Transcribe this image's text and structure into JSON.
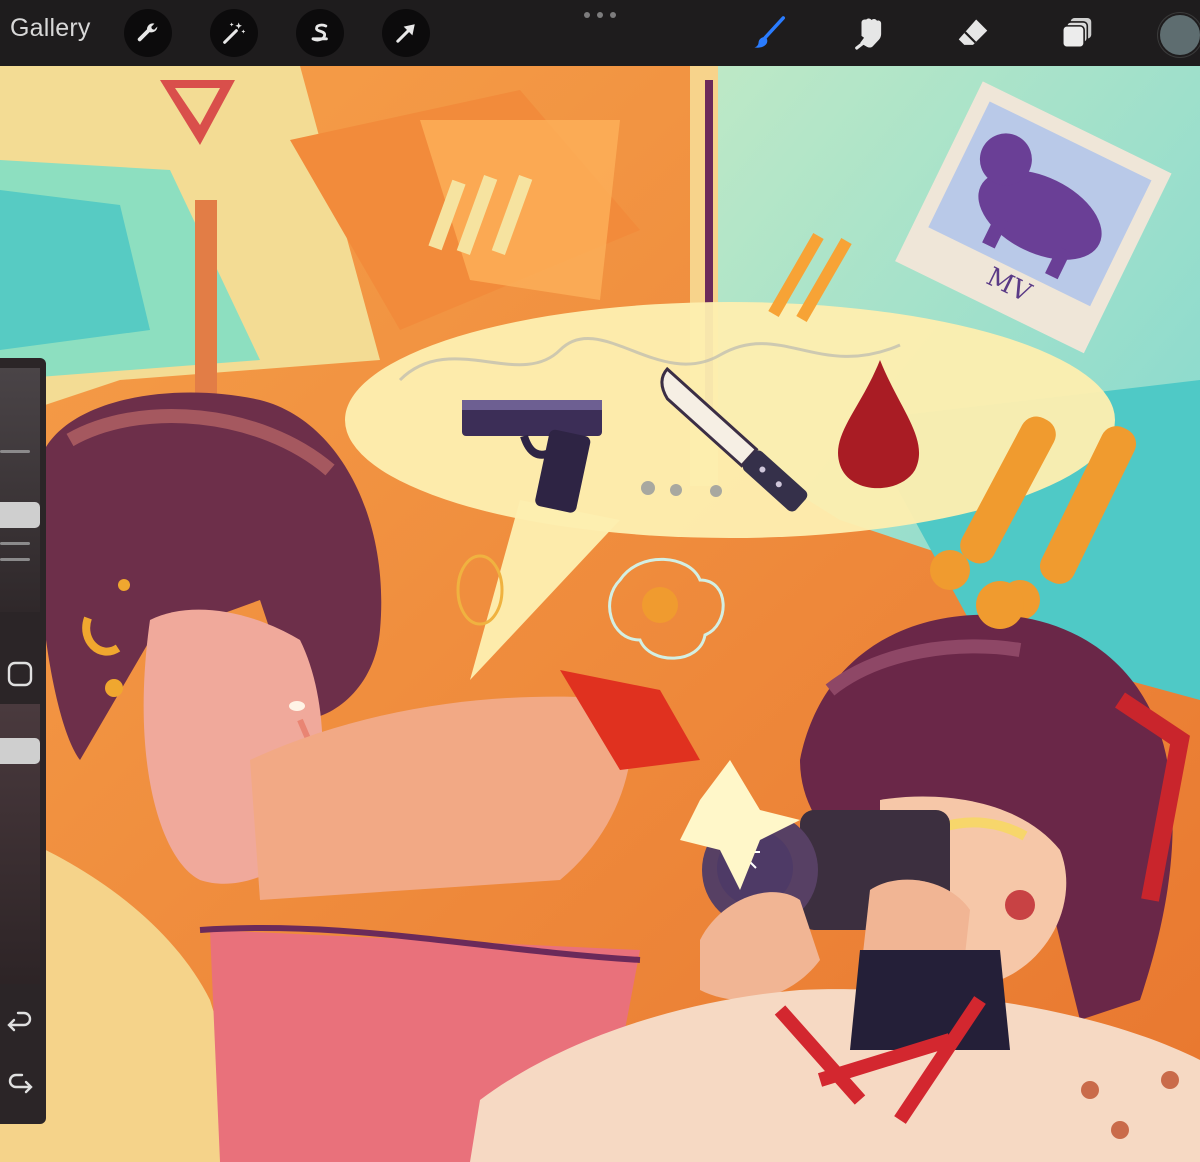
{
  "toolbar": {
    "gallery_label": "Gallery",
    "left_tools": [
      "wrench-icon",
      "magic-wand-icon",
      "selection-icon",
      "transform-arrow-icon"
    ],
    "right_tools": [
      "brush-icon",
      "smudge-icon",
      "eraser-icon",
      "layers-icon"
    ],
    "active_tool": "brush-icon",
    "active_color": "#2a7cff",
    "current_color": "#5e6d70"
  },
  "sidebar": {
    "tools": [
      "modify-square-icon",
      "undo-icon",
      "redo-icon"
    ]
  }
}
